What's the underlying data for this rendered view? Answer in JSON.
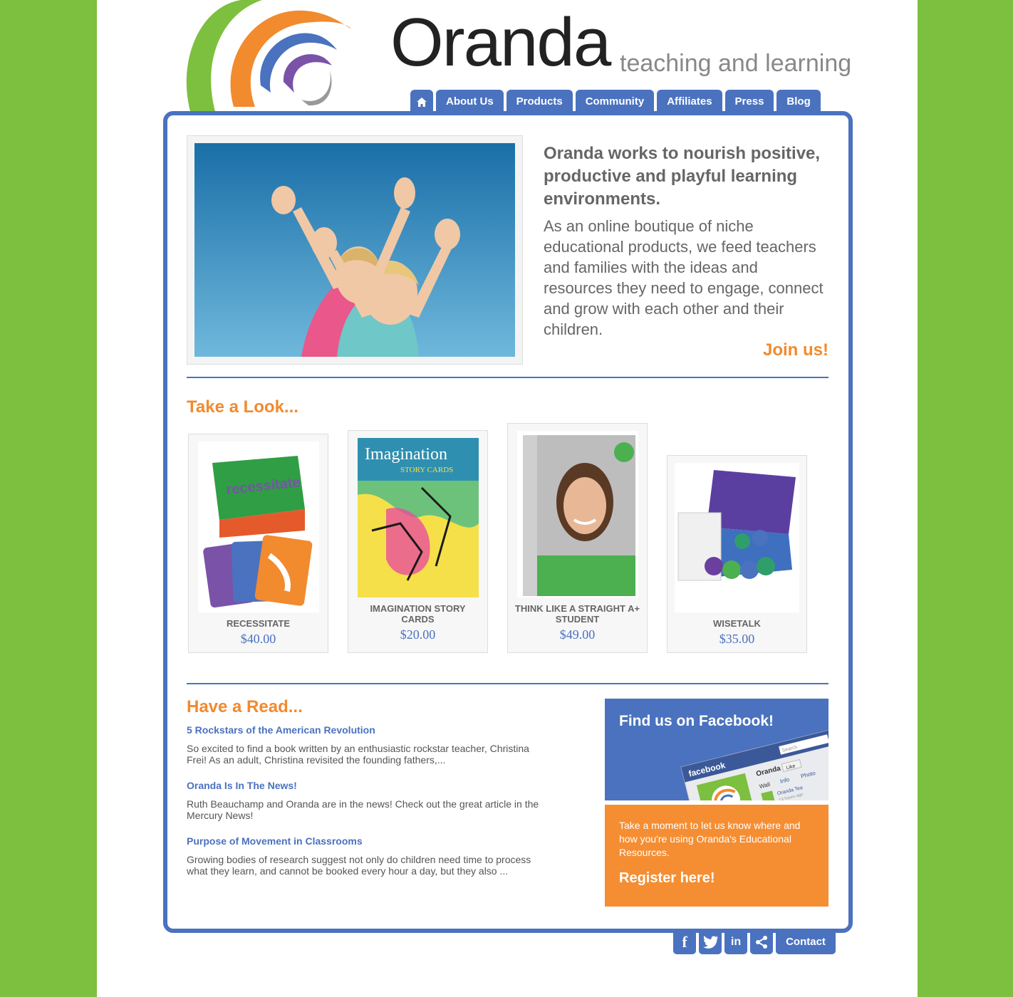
{
  "brand": {
    "name": "Oranda",
    "tagline": "teaching and learning"
  },
  "nav": {
    "home_icon": "home-icon",
    "items": [
      "About Us",
      "Products",
      "Community",
      "Affiliates",
      "Press",
      "Blog"
    ]
  },
  "intro": {
    "headline": "Oranda works to nourish positive, productive and playful learning environments.",
    "body": "As an online boutique of niche educational products, we feed teachers and families with the ideas and resources they need to engage, connect and grow with each other and their children.",
    "cta": "Join us!"
  },
  "products_section": {
    "title": "Take a Look...",
    "items": [
      {
        "name": "RECESSITATE",
        "price": "$40.00"
      },
      {
        "name": "IMAGINATION STORY CARDS",
        "price": "$20.00"
      },
      {
        "name": "THINK LIKE A STRAIGHT A+ STUDENT",
        "price": "$49.00"
      },
      {
        "name": "WISETALK",
        "price": "$35.00"
      }
    ]
  },
  "read_section": {
    "title": "Have a Read...",
    "posts": [
      {
        "title": "5 Rockstars of the American Revolution",
        "excerpt": "So excited to find a book written by an enthusiastic rockstar teacher, Christina Frei!  As an adult, Christina revisited the founding fathers,..."
      },
      {
        "title": "Oranda Is In The News!",
        "excerpt": "Ruth Beauchamp and Oranda are in the news!  Check out the great article in the Mercury News!"
      },
      {
        "title": "Purpose of Movement in Classrooms",
        "excerpt": "Growing bodies of research suggest not only do children need time to process what they learn, and cannot be booked every hour a day, but they also ..."
      }
    ]
  },
  "facebook_panel": {
    "title": "Find us on Facebook!",
    "mock": {
      "brand": "facebook",
      "page_name": "Oranda",
      "like": "Like",
      "tab_wall": "Wall",
      "tab_info": "Info",
      "tab_photos": "Photo",
      "post_name": "Oranda Tea",
      "post_time": "13 hours ago",
      "search": "Search"
    }
  },
  "register_panel": {
    "text": "Take a moment to let us know where and how you're using Oranda's Educational Resources.",
    "link": "Register here!"
  },
  "footer": {
    "icons": [
      "facebook-icon",
      "twitter-icon",
      "linkedin-icon",
      "share-icon"
    ],
    "icon_glyphs": {
      "facebook": "f",
      "linkedin": "in"
    },
    "contact": "Contact"
  },
  "colors": {
    "background_green": "#7dbf3f",
    "brand_blue": "#4a72bf",
    "accent_orange": "#f28a2e"
  }
}
